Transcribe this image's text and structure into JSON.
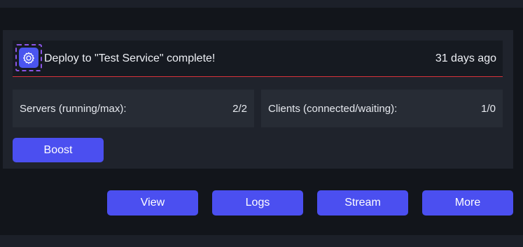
{
  "deploy": {
    "icon": "gear-icon",
    "message": "Deploy to \"Test Service\" complete!",
    "time": "31 days ago"
  },
  "stats": {
    "servers": {
      "label": "Servers (running/max):",
      "value": "2/2"
    },
    "clients": {
      "label": "Clients (connected/waiting):",
      "value": "1/0"
    }
  },
  "buttons": {
    "boost": "Boost",
    "view": "View",
    "logs": "Logs",
    "stream": "Stream",
    "more": "More"
  },
  "colors": {
    "background": "#12151b",
    "card": "#1f232c",
    "accent": "#4b4ff0",
    "divider": "#d8333a",
    "icon_focus": "#8a55e6"
  }
}
